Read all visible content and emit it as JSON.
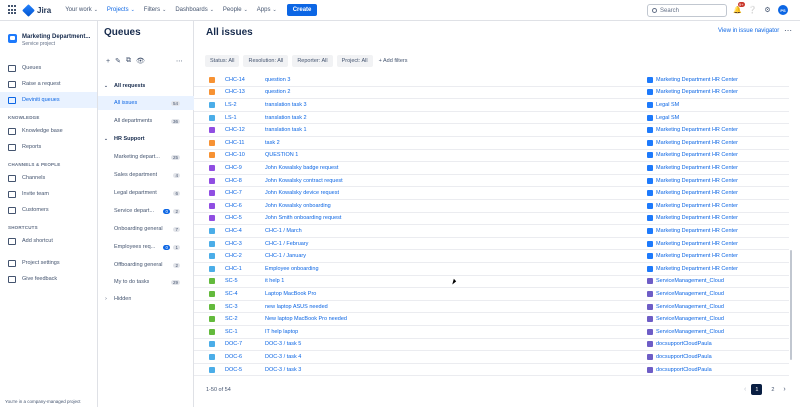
{
  "topnav": {
    "logo_text": "Jira",
    "items": [
      {
        "label": "Your work",
        "active": false
      },
      {
        "label": "Projects",
        "active": true
      },
      {
        "label": "Filters",
        "active": false
      },
      {
        "label": "Dashboards",
        "active": false
      },
      {
        "label": "People",
        "active": false
      },
      {
        "label": "Apps",
        "active": false
      }
    ],
    "create_label": "Create",
    "search_placeholder": "Search",
    "notifications_badge": "9+",
    "avatar_initials": "PS"
  },
  "sidebar": {
    "project_name": "Marketing Department...",
    "project_type": "Service project",
    "items_top": [
      {
        "label": "Queues",
        "active": false
      },
      {
        "label": "Raise a request",
        "active": false
      },
      {
        "label": "Deviniti queues",
        "active": true
      }
    ],
    "section_knowledge": "KNOWLEDGE",
    "items_knowledge": [
      {
        "label": "Knowledge base"
      },
      {
        "label": "Reports"
      }
    ],
    "section_channels": "CHANNELS & PEOPLE",
    "items_channels": [
      {
        "label": "Channels"
      },
      {
        "label": "Invite team"
      },
      {
        "label": "Customers"
      }
    ],
    "section_shortcuts": "SHORTCUTS",
    "items_shortcuts": [
      {
        "label": "Add shortcut"
      }
    ],
    "items_bottom": [
      {
        "label": "Project settings"
      },
      {
        "label": "Give feedback"
      }
    ],
    "footer": "You're in a company-managed project"
  },
  "queues": {
    "title": "Queues",
    "all_requests_label": "All requests",
    "all_issues": {
      "label": "All issues",
      "count": "54"
    },
    "all_departments": {
      "label": "All departments",
      "count": "36"
    },
    "hr_support_label": "HR Support",
    "hr_items": [
      {
        "label": "Marketing depart...",
        "count": "25",
        "badge": ""
      },
      {
        "label": "Sales department",
        "count": "4",
        "badge": ""
      },
      {
        "label": "Legal department",
        "count": "6",
        "badge": ""
      },
      {
        "label": "Service depart...",
        "count": "2",
        "badge": "0"
      },
      {
        "label": "Onboarding general",
        "count": "7",
        "badge": ""
      },
      {
        "label": "Employees req...",
        "count": "1",
        "badge": "0"
      },
      {
        "label": "Offboarding general",
        "count": "2",
        "badge": ""
      }
    ],
    "my_todo": {
      "label": "My to do tasks",
      "count": "29"
    },
    "hidden_label": "Hidden"
  },
  "main": {
    "title": "All issues",
    "view_link": "View in issue navigator",
    "filters": [
      "Status: All",
      "Resolution: All",
      "Reporter: All",
      "Project: All"
    ],
    "add_filter": "+ Add filters",
    "rows": [
      {
        "type": "question",
        "key": "CHC-14",
        "summary": "question 3",
        "org": "Marketing Department HR Center"
      },
      {
        "type": "question",
        "key": "CHC-13",
        "summary": "question 2",
        "org": "Marketing Department HR Center"
      },
      {
        "type": "task",
        "key": "LS-2",
        "summary": "translation task 3",
        "org": "Legal SM"
      },
      {
        "type": "task",
        "key": "LS-1",
        "summary": "translation task 2",
        "org": "Legal SM"
      },
      {
        "type": "purple",
        "key": "CHC-12",
        "summary": "translation task 1",
        "org": "Marketing Department HR Center"
      },
      {
        "type": "question",
        "key": "CHC-11",
        "summary": "task 2",
        "org": "Marketing Department HR Center"
      },
      {
        "type": "question",
        "key": "CHC-10",
        "summary": "QUESTION 1",
        "org": "Marketing Department HR Center"
      },
      {
        "type": "purple",
        "key": "CHC-9",
        "summary": "John Kowalsky badge request",
        "org": "Marketing Department HR Center"
      },
      {
        "type": "purple",
        "key": "CHC-8",
        "summary": "John Kowalsky contract request",
        "org": "Marketing Department HR Center"
      },
      {
        "type": "purple",
        "key": "CHC-7",
        "summary": "John Kowalsky device request",
        "org": "Marketing Department HR Center"
      },
      {
        "type": "purple",
        "key": "CHC-6",
        "summary": "John Kowalsky onboarding",
        "org": "Marketing Department HR Center"
      },
      {
        "type": "purple",
        "key": "CHC-5",
        "summary": "John Smith onboarding request",
        "org": "Marketing Department HR Center"
      },
      {
        "type": "task",
        "key": "CHC-4",
        "summary": "CHC-1 / March",
        "org": "Marketing Department HR Center"
      },
      {
        "type": "task",
        "key": "CHC-3",
        "summary": "CHC-1 / February",
        "org": "Marketing Department HR Center"
      },
      {
        "type": "task",
        "key": "CHC-2",
        "summary": "CHC-1 / January",
        "org": "Marketing Department HR Center"
      },
      {
        "type": "task",
        "key": "CHC-1",
        "summary": "Employee onboarding",
        "org": "Marketing Department HR Center"
      },
      {
        "type": "green",
        "key": "SC-5",
        "summary": "it help 1",
        "org": "ServiceManagement_Cloud"
      },
      {
        "type": "green",
        "key": "SC-4",
        "summary": "Laptop MacBook Pro",
        "org": "ServiceManagement_Cloud"
      },
      {
        "type": "green",
        "key": "SC-3",
        "summary": "new laptop ASUS needed",
        "org": "ServiceManagement_Cloud"
      },
      {
        "type": "green",
        "key": "SC-2",
        "summary": "New laptop MacBook Pro needed",
        "org": "ServiceManagement_Cloud"
      },
      {
        "type": "green",
        "key": "SC-1",
        "summary": "IT help laptop",
        "org": "ServiceManagement_Cloud"
      },
      {
        "type": "task",
        "key": "DOC-7",
        "summary": "DOC-3 / task 5",
        "org": "docsupportCloudPaula"
      },
      {
        "type": "task",
        "key": "DOC-6",
        "summary": "DOC-3 / task 4",
        "org": "docsupportCloudPaula"
      },
      {
        "type": "task",
        "key": "DOC-5",
        "summary": "DOC-3 / task 3",
        "org": "docsupportCloudPaula"
      }
    ],
    "pager_text": "1-50 of 54",
    "pages": [
      "1",
      "2"
    ],
    "current_page": "1"
  },
  "colors": {
    "accent": "#0c66e4",
    "question": "#f79233",
    "task": "#4bade8",
    "purple": "#904ee2",
    "green": "#63ba3c",
    "org_hr": "#1d7afc",
    "org_legal": "#1d7afc",
    "org_sc": "#6e5dc6",
    "org_doc": "#6e5dc6"
  }
}
